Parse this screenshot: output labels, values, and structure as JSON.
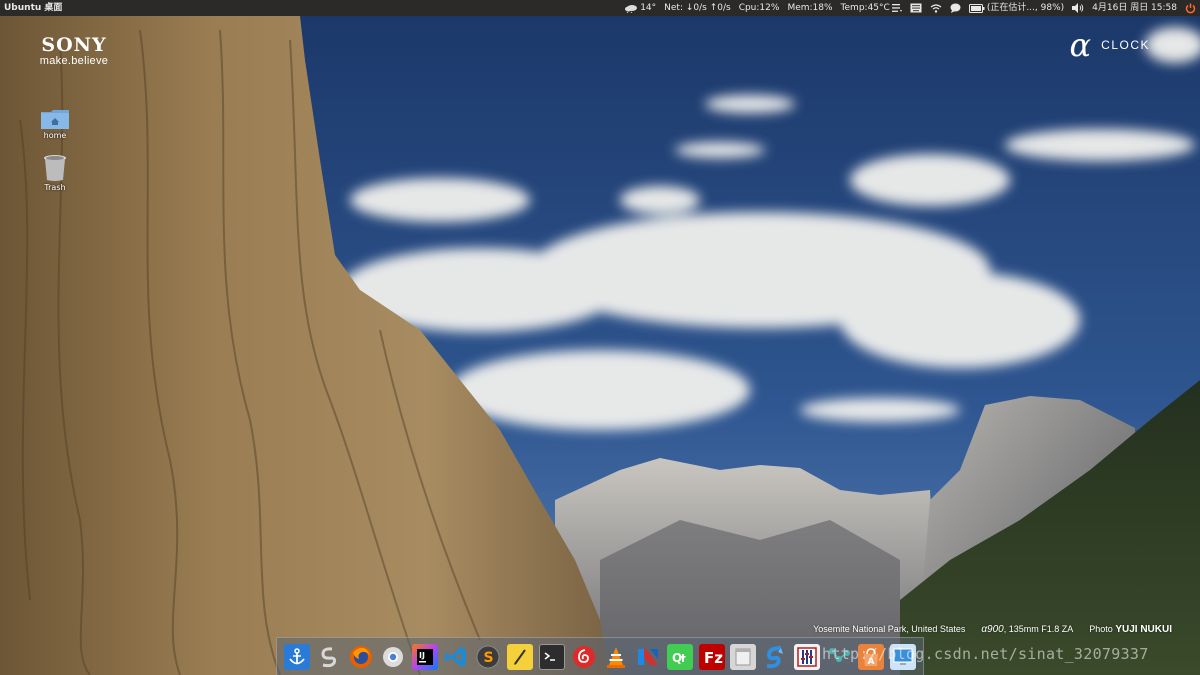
{
  "top_panel": {
    "title": "Ubuntu 桌面",
    "weather": "14°",
    "net": "Net: ↓0/s ↑0/s",
    "cpu": "Cpu:12%",
    "mem": "Mem:18%",
    "temp": "Temp:45°C",
    "battery": "(正在估计..., 98%)",
    "datetime": "4月16日 周日 15:58",
    "icons": [
      "weather-icon",
      "menu-lines-icon",
      "keyboard-icon",
      "wifi-icon",
      "chat-icon",
      "battery-icon",
      "volume-icon",
      "power-icon"
    ]
  },
  "brand": {
    "sony_logo": "SONY",
    "sony_tagline": "make.believe",
    "clock_symbol": "α",
    "clock_label": "CLOCK"
  },
  "desktop": {
    "icons": [
      {
        "label": "home",
        "icon": "home-folder-icon"
      },
      {
        "label": "Trash",
        "icon": "trash-icon"
      }
    ]
  },
  "caption": {
    "location": "Yosemite National Park, United States",
    "model": "α900",
    "lens": ", 135mm F1.8 ZA",
    "credit_prefix": "Photo",
    "photographer": "YUJI NUKUI"
  },
  "dock": {
    "apps": [
      "anchor-app-icon",
      "sogou-app-icon",
      "firefox-app-icon",
      "chromium-app-icon",
      "intellij-app-icon",
      "vscode-app-icon",
      "sublime-app-icon",
      "editor-app-icon",
      "terminal-app-icon",
      "netease-music-app-icon",
      "vlc-app-icon",
      "wps-app-icon",
      "qt-creator-app-icon",
      "filezilla-app-icon",
      "files-app-icon",
      "shadowsocks-app-icon",
      "mixer-app-icon",
      "network-app-icon",
      "software-center-app-icon",
      "display-app-icon"
    ]
  },
  "watermark": "http://blog.csdn.net/sinat_32079337",
  "colors": {
    "panel": "#2b2a28",
    "sky_top": "#1d3a6c",
    "sky_bottom": "#3f6aa5",
    "power": "#ff6a2a"
  }
}
